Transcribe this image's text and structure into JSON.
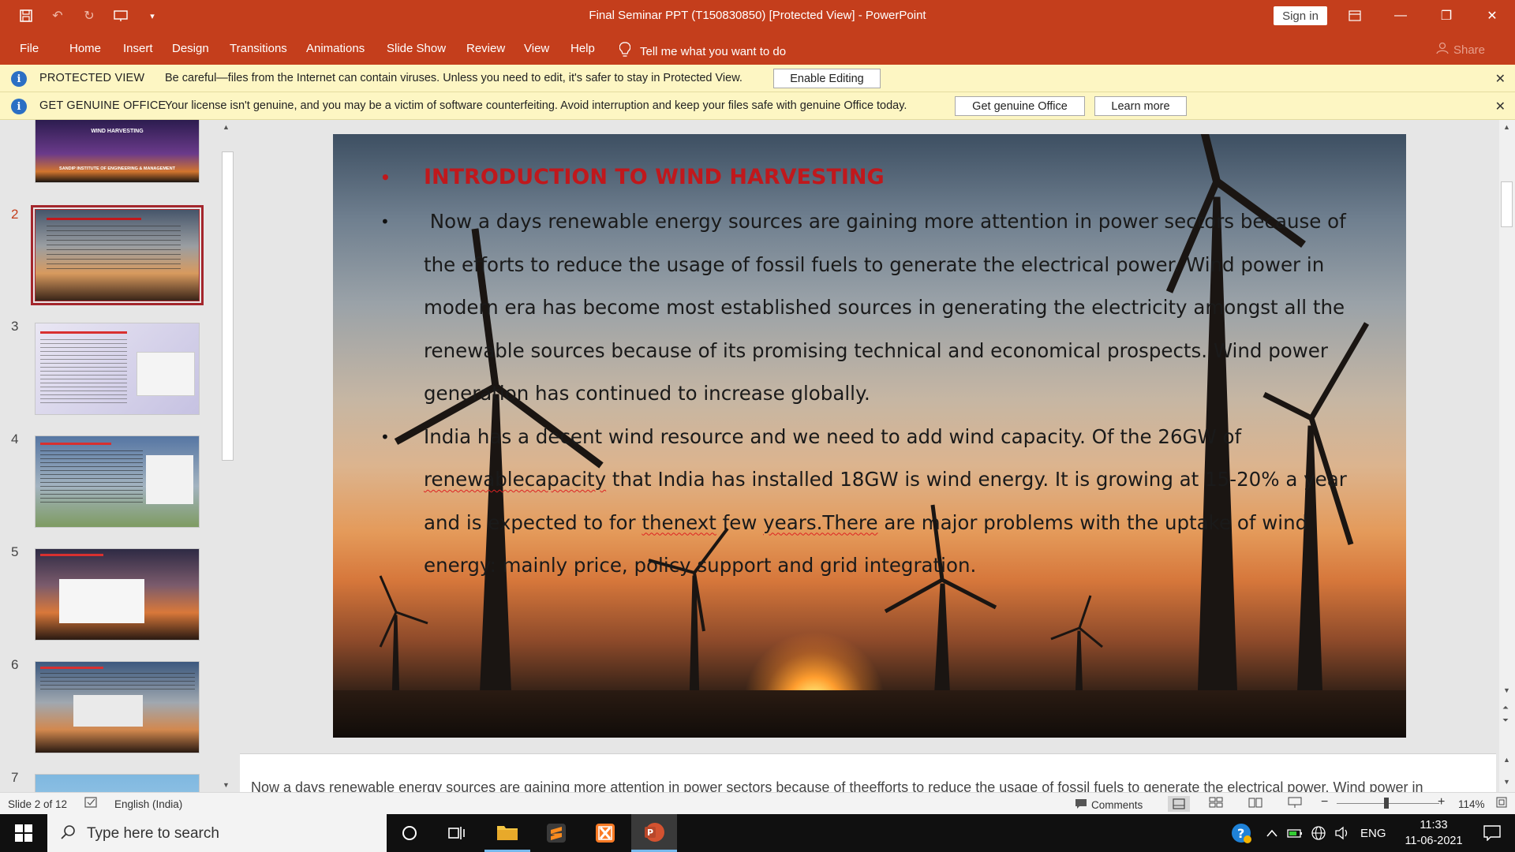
{
  "titlebar": {
    "title": "Final Seminar PPT (T150830850) [Protected View]  -  PowerPoint",
    "signin_label": "Sign in"
  },
  "ribbon": {
    "tabs": [
      "File",
      "Home",
      "Insert",
      "Design",
      "Transitions",
      "Animations",
      "Slide Show",
      "Review",
      "View",
      "Help"
    ],
    "tellme": "Tell me what you want to do",
    "share": "Share"
  },
  "protected_bar": {
    "label": "PROTECTED VIEW",
    "message": "Be careful—files from the Internet can contain viruses. Unless you need to edit, it's safer to stay in Protected View.",
    "button": "Enable Editing"
  },
  "genuine_bar": {
    "label": "GET GENUINE OFFICE",
    "message": "Your license isn't genuine, and you may be a victim of software counterfeiting. Avoid interruption and keep your files safe with genuine Office today.",
    "button1": "Get genuine Office",
    "button2": "Learn more"
  },
  "thumbnails": [
    {
      "num": "",
      "title": "WIND HARVESTING",
      "subtitle": "SANDIP INSTITUTE OF ENGINEERING & MANAGEMENT"
    },
    {
      "num": "2",
      "title": ""
    },
    {
      "num": "3",
      "title": ""
    },
    {
      "num": "4",
      "title": ""
    },
    {
      "num": "5",
      "title": ""
    },
    {
      "num": "6",
      "title": ""
    },
    {
      "num": "7",
      "title": ""
    }
  ],
  "slide": {
    "title": "INTRODUCTION TO WIND HARVESTING",
    "p1": " Now a days renewable energy sources are gaining more attention in power sectors because of the efforts to reduce the usage of fossil fuels to generate the electrical power. Wind power in modern era has become most established sources in generating the electricity amongst all the renewable sources because of its promising technical and economical prospects. Wind power generation has continued to increase globally.",
    "p2_a": "India has a decent wind resource and we need to add wind capacity. Of the 26GW of ",
    "p2_sq1": "renewablecapacity",
    "p2_b": " that India has installed 18GW is wind energy. It is growing at 15-20% a year and is expected to for ",
    "p2_sq2": "thenext",
    "p2_c": " few ",
    "p2_sq3": "years.There",
    "p2_d": " are major problems with the uptake of wind energy: mainly price, policy support and grid integration."
  },
  "notes": {
    "text": "Now a days renewable energy sources are gaining more attention in power sectors because of theefforts to reduce the usage of fossil fuels to generate the electrical power. Wind power in"
  },
  "statusbar": {
    "slide_count": "Slide 2 of 12",
    "language": "English (India)",
    "comments": "Comments",
    "zoom": "114%"
  },
  "taskbar": {
    "search_placeholder": "Type here to search",
    "lang": "ENG",
    "time": "11:33",
    "date": "11-06-2021"
  },
  "colors": {
    "accent": "#c43e1c",
    "message_bar": "#fdf6c3",
    "slide_title": "#c0181c"
  }
}
